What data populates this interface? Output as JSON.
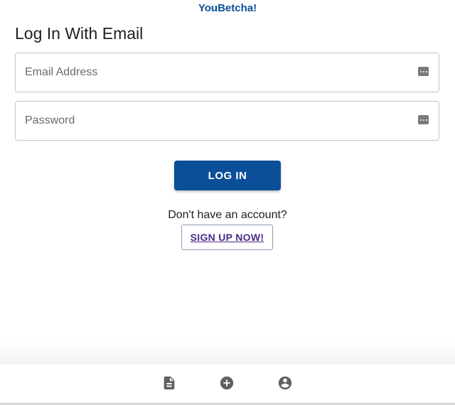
{
  "app": {
    "title": "YouBetcha!"
  },
  "login": {
    "heading": "Log In With Email",
    "email_placeholder": "Email Address",
    "password_placeholder": "Password",
    "login_label": "LOG IN",
    "signup_prompt": "Don't have an account?",
    "signup_label": "SIGN UP NOW!"
  },
  "nav": {
    "items": [
      {
        "icon": "document-icon"
      },
      {
        "icon": "add-circle-icon"
      },
      {
        "icon": "account-circle-icon"
      }
    ]
  },
  "colors": {
    "brand": "#0a4f97",
    "button": "#0b4f98",
    "signup_text": "#4a2b86",
    "icon": "#616161"
  }
}
